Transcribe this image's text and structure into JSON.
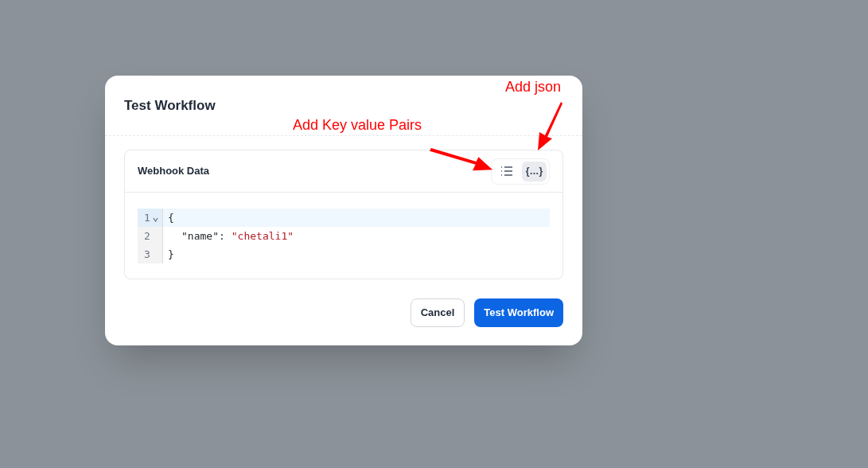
{
  "dialog": {
    "title": "Test Workflow",
    "card": {
      "title": "Webhook Data",
      "modes": [
        {
          "kind": "list",
          "selected": false
        },
        {
          "kind": "json",
          "label": "{…}",
          "selected": true
        }
      ],
      "editor": {
        "lines": [
          {
            "number": "1",
            "foldable": true,
            "active": true,
            "indented": false,
            "tokens": [
              {
                "kind": "punct",
                "text": "{"
              }
            ]
          },
          {
            "number": "2",
            "foldable": false,
            "active": false,
            "indented": true,
            "tokens": [
              {
                "kind": "key",
                "text": "\"name\""
              },
              {
                "kind": "punct",
                "text": ":"
              },
              {
                "kind": "string",
                "text": "\"chetali1\""
              }
            ]
          },
          {
            "number": "3",
            "foldable": false,
            "active": false,
            "indented": false,
            "tokens": [
              {
                "kind": "punct",
                "text": "}"
              }
            ]
          }
        ]
      }
    },
    "buttons": [
      {
        "kind": "secondary",
        "label": "Cancel"
      },
      {
        "kind": "primary",
        "label": "Test Workflow"
      }
    ]
  },
  "annotations": [
    {
      "text": "Add Key value Pairs"
    },
    {
      "text": "Add json"
    }
  ]
}
